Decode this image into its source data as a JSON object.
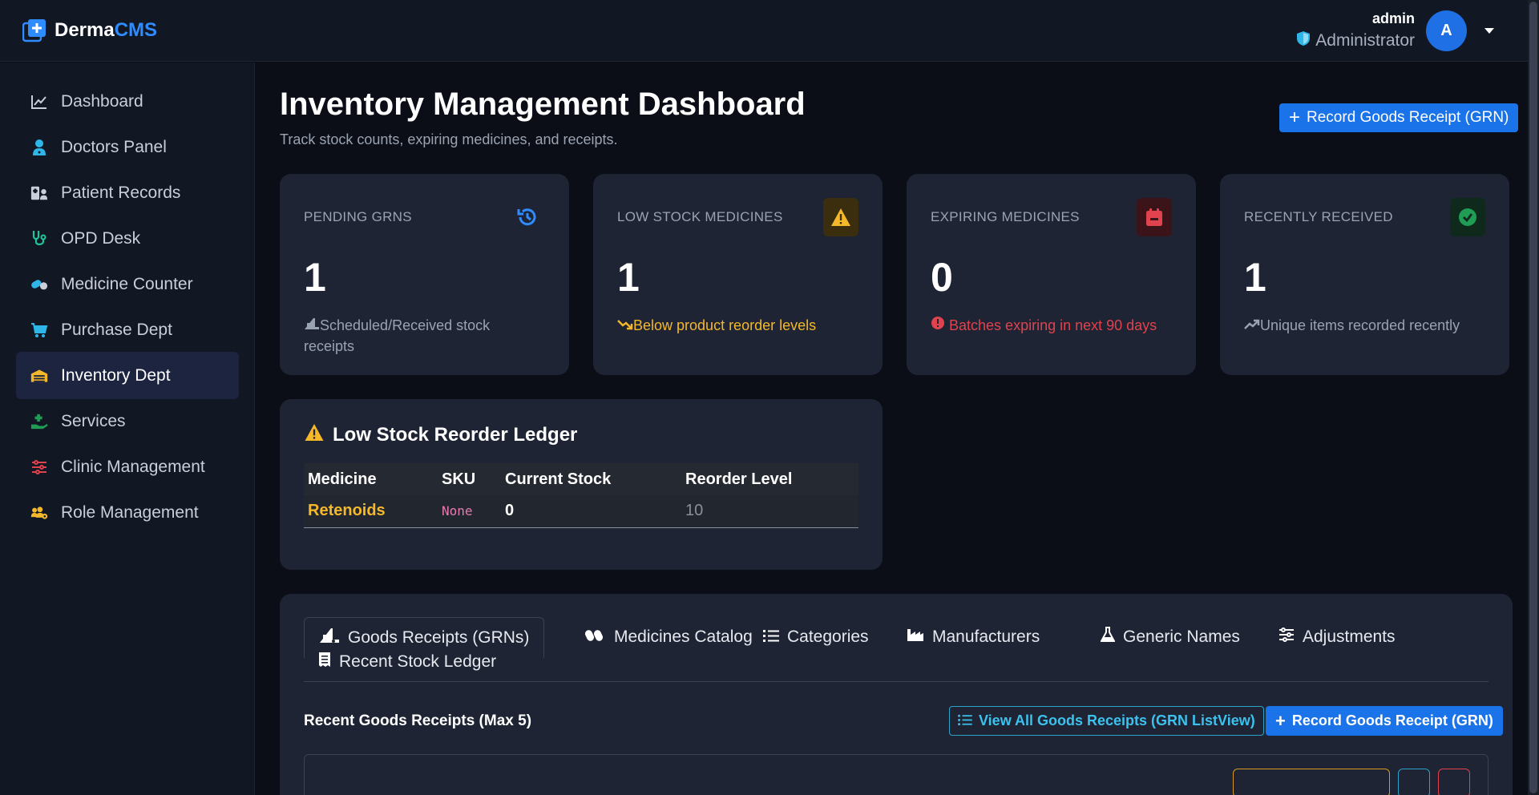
{
  "brand": {
    "name_main": "Derma",
    "name_accent": "CMS"
  },
  "user": {
    "name": "admin",
    "role": "Administrator",
    "avatar_letter": "A"
  },
  "sidebar": {
    "items": [
      {
        "label": "Dashboard",
        "icon": "chart-line-icon"
      },
      {
        "label": "Doctors Panel",
        "icon": "user-doctor-icon"
      },
      {
        "label": "Patient Records",
        "icon": "hospital-user-icon"
      },
      {
        "label": "OPD Desk",
        "icon": "stethoscope-icon"
      },
      {
        "label": "Medicine Counter",
        "icon": "pills-icon"
      },
      {
        "label": "Purchase Dept",
        "icon": "cart-icon"
      },
      {
        "label": "Inventory Dept",
        "icon": "warehouse-icon"
      },
      {
        "label": "Services",
        "icon": "hand-holding-medical-icon"
      },
      {
        "label": "Clinic Management",
        "icon": "sliders-icon"
      },
      {
        "label": "Role Management",
        "icon": "users-gear-icon"
      }
    ],
    "active_index": 6
  },
  "page": {
    "title": "Inventory Management Dashboard",
    "subtitle": "Track stock counts, expiring medicines, and receipts.",
    "header_button": "Record Goods Receipt (GRN)"
  },
  "stats": [
    {
      "label": "PENDING GRNS",
      "value": "1",
      "note": "Scheduled/Received stock receipts",
      "note_color": "#9aa3b2",
      "icon": "history-icon",
      "icon_color": "#2f8cff"
    },
    {
      "label": "LOW STOCK MEDICINES",
      "value": "1",
      "note": "Below product reorder levels",
      "note_color": "#f5b82a",
      "icon": "warning-icon",
      "icon_color": "#f5b82a"
    },
    {
      "label": "EXPIRING MEDICINES",
      "value": "0",
      "note": "Batches expiring in next 90 days",
      "note_color": "#e0424e",
      "icon": "calendar-icon",
      "icon_color": "#e0424e"
    },
    {
      "label": "RECENTLY RECEIVED",
      "value": "1",
      "note": "Unique items recorded recently",
      "note_color": "#9aa3b2",
      "icon": "check-circle-icon",
      "icon_color": "#1f9d55"
    }
  ],
  "ledger": {
    "title": "Low Stock Reorder Ledger",
    "columns": [
      "Medicine",
      "SKU",
      "Current Stock",
      "Reorder Level"
    ],
    "rows": [
      {
        "medicine": "Retenoids",
        "sku": "None",
        "current_stock": "0",
        "reorder_level": "10"
      }
    ]
  },
  "tabs": [
    {
      "label": "Goods Receipts (GRNs)",
      "icon": "truck-ramp-icon"
    },
    {
      "label": "Medicines Catalog",
      "icon": "capsules-icon"
    },
    {
      "label": "Categories",
      "icon": "list-icon"
    },
    {
      "label": "Manufacturers",
      "icon": "industry-icon"
    },
    {
      "label": "Generic Names",
      "icon": "flask-icon"
    },
    {
      "label": "Adjustments",
      "icon": "sliders-icon"
    },
    {
      "label": "Recent Stock Ledger",
      "icon": "receipt-icon"
    }
  ],
  "recent": {
    "title": "Recent Goods Receipts (Max 5)",
    "view_all": "View All Goods Receipts (GRN ListView)",
    "record": "Record Goods Receipt (GRN)"
  }
}
